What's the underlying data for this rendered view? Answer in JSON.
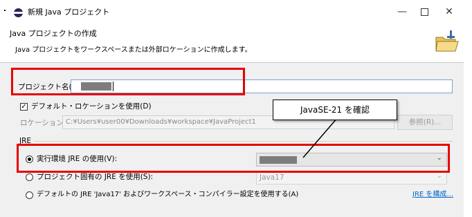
{
  "window": {
    "title": "新規 Java プロジェクト"
  },
  "header": {
    "title": "Java プロジェクトの作成",
    "description": "Java プロジェクトをワークスペースまたは外部ロケーションに作成します。"
  },
  "project": {
    "name_label": "プロジェクト名(P):"
  },
  "location": {
    "default_checkbox_label": "デフォルト・ロケーションを使用(D)",
    "default_checked": true,
    "label": "ロケーション(L):",
    "value": "C:¥Users¥user00¥Downloads¥workspace¥JavaProject1",
    "browse_button": "参照(R)..."
  },
  "jre": {
    "group_label": "JRE",
    "options": [
      {
        "label": "実行環境 JRE の使用(V):",
        "selected": true
      },
      {
        "label": "プロジェクト固有の JRE を使用(S):",
        "selected": false,
        "value": "Java17"
      },
      {
        "label": "デフォルトの JRE 'Java17' およびワークスペース・コンパイラー設定を使用する(A)",
        "selected": false
      }
    ],
    "configure_link": "JRE を構成..."
  },
  "callout": {
    "text": "JavaSE-21 を確認"
  },
  "colors": {
    "highlight": "#e60000",
    "link": "#0066cc"
  }
}
